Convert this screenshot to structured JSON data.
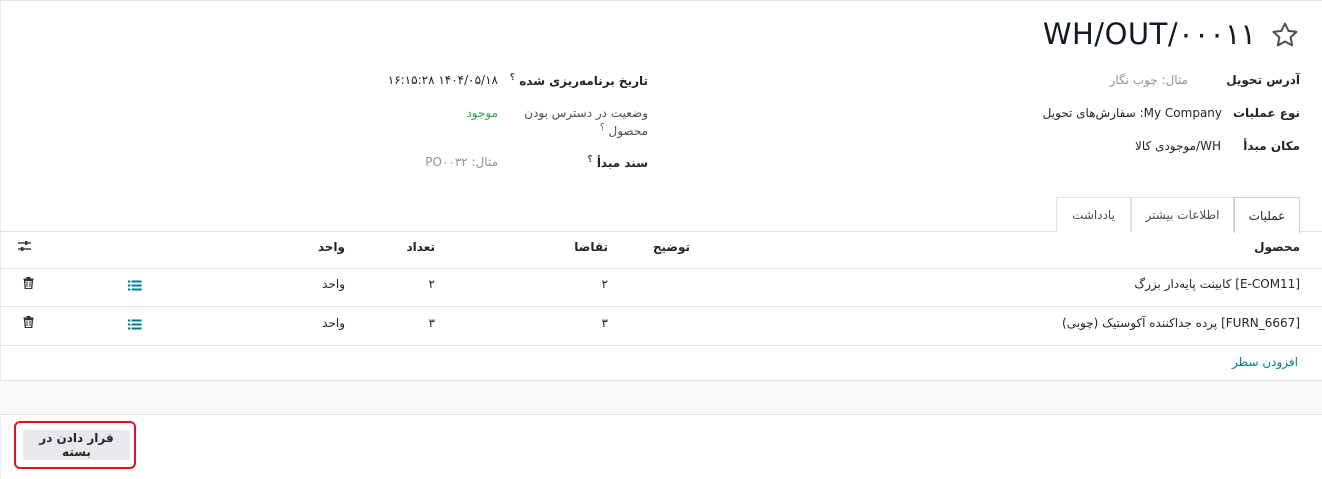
{
  "header": {
    "title": "WH/OUT/۰۰۰۱۱"
  },
  "fields_right": [
    {
      "label": "آدرس تحویل",
      "value": "مثال: چوب نگار",
      "is_placeholder": true
    },
    {
      "label": "نوع عملیات",
      "value": "My Company: سفارش‌های تحویل",
      "is_placeholder": false
    },
    {
      "label": "مکان مبدأ",
      "value": "WH/موجودی کالا",
      "is_placeholder": false
    }
  ],
  "fields_left": {
    "scheduled": {
      "label": "تاریخ برنامه‌ریزی شده",
      "help": "؟",
      "value": "۱۴۰۴/۰۵/۱۸ ۱۶:۱۵:۲۸"
    },
    "availability": {
      "label_line1": "وضعیت در دسترس بودن",
      "label_line2": "محصول",
      "help": "؟",
      "value": "موجود"
    },
    "source_doc": {
      "label": "سند مبدأ",
      "help": "؟",
      "placeholder": "مثال: PO۰۰۳۲"
    }
  },
  "tabs": [
    {
      "label": "عملیات",
      "active": true
    },
    {
      "label": "اطلاعات بیشتر",
      "active": false
    },
    {
      "label": "یادداشت",
      "active": false
    }
  ],
  "table": {
    "columns": {
      "product": "محصول",
      "description": "توضیح",
      "demand": "تقاضا",
      "quantity": "تعداد",
      "unit": "واحد"
    },
    "rows": [
      {
        "product": "[E-COM11] کابینت پایه‌دار بزرگ",
        "description": "",
        "demand": "۲",
        "quantity": "۲",
        "unit": "واحد"
      },
      {
        "product": "[FURN_6667] پرده جداکننده آکوستیک (چوبی)",
        "description": "",
        "demand": "۳",
        "quantity": "۳",
        "unit": "واحد"
      }
    ],
    "add_line": "افزودن سطر"
  },
  "footer": {
    "put_in_pack": "قرار دادن در بسته"
  },
  "colors": {
    "link": "#017e84",
    "available": "#28a745",
    "highlight": "#e0141e"
  }
}
